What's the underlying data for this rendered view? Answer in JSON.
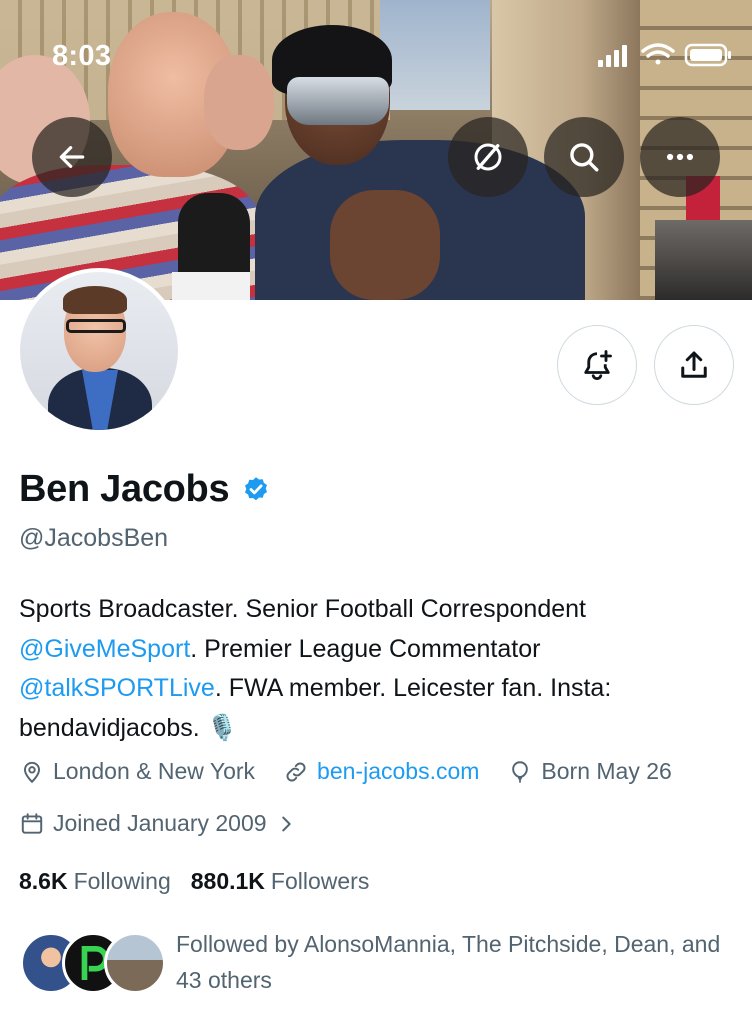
{
  "status_bar": {
    "time": "8:03"
  },
  "header": {
    "back_icon": "arrow-left-icon",
    "grok_icon": "slash-circle-icon",
    "search_icon": "search-icon",
    "more_icon": "ellipsis-icon"
  },
  "actions": {
    "notify_icon": "bell-plus-icon",
    "share_icon": "share-upload-icon"
  },
  "profile": {
    "name": "Ben Jacobs",
    "verified": true,
    "handle": "@JacobsBen",
    "bio": {
      "p1": "Sports Broadcaster. Senior Football Correspondent ",
      "mention1": "@GiveMeSport",
      "p2": ". Premier League Commentator ",
      "mention2": "@talkSPORTLive",
      "p3": ". FWA member. Leicester fan. Insta: bendavidjacobs. 🎙️"
    },
    "location": "London & New York",
    "website": "ben-jacobs.com",
    "birthday": "Born May 26",
    "joined": "Joined January 2009",
    "following_count": "8.6K",
    "following_label": "Following",
    "followers_count": "880.1K",
    "followers_label": "Followers",
    "followed_by": "Followed by AlonsoMannia, The Pitchside, Dean, and 43 others"
  },
  "colors": {
    "accent": "#1d9bf0",
    "secondary_text": "#536471",
    "primary_text": "#0f1419"
  }
}
